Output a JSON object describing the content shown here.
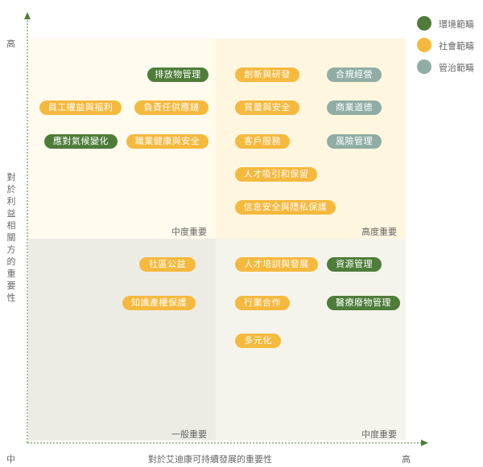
{
  "legend": [
    {
      "label": "環境範疇",
      "color": "#4e7d3a"
    },
    {
      "label": "社會範疇",
      "color": "#f5b93e"
    },
    {
      "label": "管治範疇",
      "color": "#8fada5"
    }
  ],
  "axes": {
    "y_title": "對於利益相關方的重要性",
    "y_high": "高",
    "x_title": "對於艾迪康可持續發展的重要性",
    "x_low": "中",
    "x_high": "高"
  },
  "quadrants": {
    "top_left": "中度重要",
    "top_right": "高度重要",
    "bottom_left": "一般重要",
    "bottom_right": "中度重要"
  },
  "topics": {
    "t1": "排放物管理",
    "t2": "員工權益與福利",
    "t3": "負責任供應鏈",
    "t4": "應對氣候變化",
    "t5": "職業健康與安全",
    "t6": "創新與研發",
    "t7": "合規經營",
    "t8": "質量與安全",
    "t9": "商業道德",
    "t10": "客戶服務",
    "t11": "風險管理",
    "t12": "人才吸引和保留",
    "t13": "信息安全與隱私保護",
    "t14": "社區公益",
    "t15": "知識產權保護",
    "t16": "人才培訓與發展",
    "t17": "資源管理",
    "t18": "行業合作",
    "t19": "醫療廢物管理",
    "t20": "多元化"
  }
}
